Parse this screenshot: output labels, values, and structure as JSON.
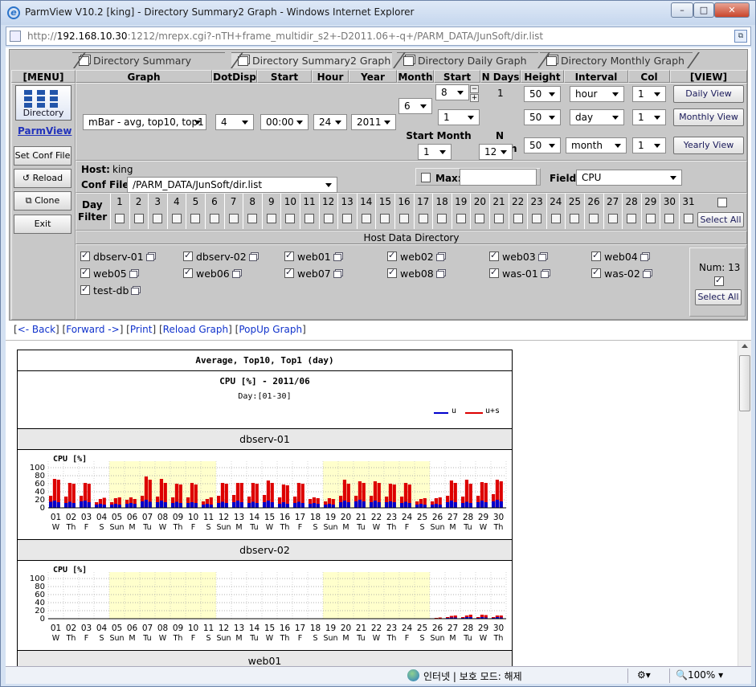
{
  "window": {
    "title": "ParmView V10.2 [king] - Directory Summary2 Graph - Windows Internet Explorer",
    "min": "–",
    "max": "□",
    "close": "✕"
  },
  "address": {
    "prefix": "http://",
    "host": "192.168.10.30",
    "rest": ":1212/mrepx.cgi?-nTH+frame_multidir_s2+-D2011.06+-q+/PARM_DATA/JunSoft/dir.list"
  },
  "tabs": [
    "Directory Summary Graph",
    "Directory Summary2 Graph",
    "Directory Daily Graph",
    "Directory Monthly Graph"
  ],
  "headers": {
    "menu": "[MENU]",
    "graph": "Graph",
    "dotdisp": "DotDisp",
    "starthour": "Start hour",
    "hour": "Hour",
    "year": "Year",
    "month": "Month",
    "startday": "Start Day",
    "ndays": "N Days",
    "height": "Height",
    "interval": "Interval",
    "col": "Col",
    "view": "[VIEW]",
    "startmonth": "Start Month",
    "nmonth": "N Month"
  },
  "menu": {
    "directory": "Directory",
    "parmview": "ParmView",
    "setconf": "Set Conf File",
    "reload": "Reload",
    "clone": "Clone",
    "exit": "Exit"
  },
  "controls": {
    "graph": "mBar - avg, top10, top1",
    "dotdisp": "4",
    "starthour": "00:00",
    "hour": "24",
    "year": "2011",
    "month": "6",
    "startday": "8",
    "ndays": "1",
    "startday2": "1",
    "height1": "50",
    "height2": "50",
    "height3": "50",
    "interval1": "hour",
    "interval2": "day",
    "interval3": "month",
    "col1": "1",
    "col2": "1",
    "col3": "1",
    "startmonth": "1",
    "nmonth": "12",
    "spinup": "−",
    "spindown": "+"
  },
  "view": {
    "daily": "Daily View",
    "monthly": "Monthly View",
    "yearly": "Yearly View"
  },
  "host": {
    "label": "Host:",
    "value": "king",
    "conflabel": "Conf File:",
    "confvalue": "/PARM_DATA/JunSoft/dir.list",
    "maxlabel": "Max:",
    "fieldlabel": "Field:",
    "fieldvalue": "CPU"
  },
  "dayfilter": {
    "label1": "Day",
    "label2": "Filter",
    "days": [
      "1",
      "2",
      "3",
      "4",
      "5",
      "6",
      "7",
      "8",
      "9",
      "10",
      "11",
      "12",
      "13",
      "14",
      "15",
      "16",
      "17",
      "18",
      "19",
      "20",
      "21",
      "22",
      "23",
      "24",
      "25",
      "26",
      "27",
      "28",
      "29",
      "30",
      "31"
    ],
    "selectall": "Select All"
  },
  "hostdir": {
    "title": "Host Data Directory",
    "hosts": [
      "dbserv-01",
      "dbserv-02",
      "web01",
      "web02",
      "web03",
      "web04",
      "web05",
      "web06",
      "web07",
      "web08",
      "was-01",
      "was-02",
      "test-db"
    ],
    "num": "Num: 13",
    "selectall": "Select All"
  },
  "links": {
    "back": "<- Back",
    "forward": "Forward ->",
    "print": "Print",
    "reload": "Reload Graph",
    "popup": "PopUp Graph"
  },
  "graph": {
    "title": "Average, Top10, Top1 (day)",
    "subtitle": "CPU [%] - 2011/06",
    "days_label": "Day:[01-30]",
    "legend": [
      {
        "name": "u",
        "color": "#0000cc"
      },
      {
        "name": "u+s",
        "color": "#dd0000"
      }
    ],
    "chart_label": "CPU [%]",
    "next_host_partial": "web01"
  },
  "status": {
    "text": "인터넷 | 보호 모드: 해제",
    "zoom": "100%"
  },
  "chart_data": [
    {
      "type": "bar",
      "title": "dbserv-01",
      "ylabel": "CPU [%]",
      "ylim": [
        0,
        100
      ],
      "yticks": [
        0,
        20,
        40,
        60,
        80,
        100
      ],
      "categories": [
        "01",
        "02",
        "03",
        "04",
        "05",
        "06",
        "07",
        "08",
        "09",
        "10",
        "11",
        "12",
        "13",
        "14",
        "15",
        "16",
        "17",
        "18",
        "19",
        "20",
        "21",
        "22",
        "23",
        "24",
        "25",
        "26",
        "27",
        "28",
        "29",
        "30"
      ],
      "weekdays": [
        "W",
        "Th",
        "F",
        "S",
        "Sun",
        "M",
        "Tu",
        "W",
        "Th",
        "F",
        "S",
        "Sun",
        "M",
        "Tu",
        "W",
        "Th",
        "F",
        "S",
        "Sun",
        "M",
        "Tu",
        "W",
        "Th",
        "F",
        "S",
        "Sun",
        "M",
        "Tu",
        "W",
        "Th"
      ],
      "weekend_bands": [
        [
          "05",
          "11"
        ],
        [
          "19",
          "25"
        ]
      ],
      "series": [
        {
          "name": "u",
          "color": "#0000cc",
          "values": [
            [
              15,
              18,
              14
            ],
            [
              12,
              15,
              12
            ],
            [
              16,
              18,
              14
            ],
            [
              8,
              10,
              8
            ],
            [
              8,
              10,
              8
            ],
            [
              10,
              12,
              10
            ],
            [
              16,
              20,
              15
            ],
            [
              14,
              18,
              14
            ],
            [
              12,
              15,
              12
            ],
            [
              12,
              14,
              12
            ],
            [
              8,
              10,
              8
            ],
            [
              12,
              15,
              12
            ],
            [
              14,
              18,
              14
            ],
            [
              12,
              15,
              12
            ],
            [
              14,
              18,
              14
            ],
            [
              10,
              14,
              10
            ],
            [
              12,
              15,
              12
            ],
            [
              10,
              12,
              10
            ],
            [
              8,
              10,
              8
            ],
            [
              14,
              18,
              14
            ],
            [
              16,
              20,
              16
            ],
            [
              14,
              18,
              14
            ],
            [
              14,
              16,
              14
            ],
            [
              12,
              15,
              12
            ],
            [
              8,
              10,
              8
            ],
            [
              8,
              10,
              8
            ],
            [
              14,
              18,
              14
            ],
            [
              12,
              15,
              12
            ],
            [
              14,
              18,
              14
            ],
            [
              16,
              20,
              16
            ]
          ]
        },
        {
          "name": "u+s",
          "color": "#dd0000",
          "values": [
            [
              30,
              72,
              70
            ],
            [
              28,
              62,
              60
            ],
            [
              30,
              62,
              60
            ],
            [
              14,
              22,
              25
            ],
            [
              14,
              24,
              26
            ],
            [
              20,
              26,
              22
            ],
            [
              30,
              78,
              70
            ],
            [
              28,
              72,
              62
            ],
            [
              26,
              60,
              58
            ],
            [
              26,
              62,
              58
            ],
            [
              16,
              22,
              26
            ],
            [
              30,
              62,
              60
            ],
            [
              32,
              62,
              62
            ],
            [
              28,
              62,
              60
            ],
            [
              32,
              68,
              62
            ],
            [
              26,
              58,
              56
            ],
            [
              28,
              62,
              60
            ],
            [
              22,
              26,
              24
            ],
            [
              16,
              24,
              22
            ],
            [
              30,
              70,
              60
            ],
            [
              30,
              66,
              62
            ],
            [
              30,
              66,
              62
            ],
            [
              28,
              60,
              58
            ],
            [
              28,
              62,
              58
            ],
            [
              16,
              22,
              24
            ],
            [
              16,
              24,
              26
            ],
            [
              30,
              68,
              62
            ],
            [
              28,
              70,
              60
            ],
            [
              30,
              64,
              62
            ],
            [
              34,
              70,
              66
            ]
          ]
        }
      ]
    },
    {
      "type": "bar",
      "title": "dbserv-02",
      "ylabel": "CPU [%]",
      "ylim": [
        0,
        100
      ],
      "yticks": [
        0,
        20,
        40,
        60,
        80,
        100
      ],
      "categories": [
        "01",
        "02",
        "03",
        "04",
        "05",
        "06",
        "07",
        "08",
        "09",
        "10",
        "11",
        "12",
        "13",
        "14",
        "15",
        "16",
        "17",
        "18",
        "19",
        "20",
        "21",
        "22",
        "23",
        "24",
        "25",
        "26",
        "27",
        "28",
        "29",
        "30"
      ],
      "weekdays": [
        "W",
        "Th",
        "F",
        "S",
        "Sun",
        "M",
        "Tu",
        "W",
        "Th",
        "F",
        "S",
        "Sun",
        "M",
        "Tu",
        "W",
        "Th",
        "F",
        "S",
        "Sun",
        "M",
        "Tu",
        "W",
        "Th",
        "F",
        "S",
        "Sun",
        "M",
        "Tu",
        "W",
        "Th"
      ],
      "weekend_bands": [
        [
          "05",
          "11"
        ],
        [
          "19",
          "25"
        ]
      ],
      "series": [
        {
          "name": "u",
          "color": "#0000cc",
          "values": [
            [
              0,
              0,
              0
            ],
            [
              0,
              0,
              0
            ],
            [
              0,
              0,
              0
            ],
            [
              0,
              0,
              0
            ],
            [
              0,
              0,
              0
            ],
            [
              0,
              0,
              0
            ],
            [
              0,
              0,
              0
            ],
            [
              0,
              0,
              0
            ],
            [
              0,
              0,
              0
            ],
            [
              0,
              0,
              0
            ],
            [
              0,
              0,
              0
            ],
            [
              0,
              0,
              0
            ],
            [
              0,
              0,
              0
            ],
            [
              0,
              0,
              0
            ],
            [
              0,
              0,
              0
            ],
            [
              0,
              0,
              0
            ],
            [
              0,
              0,
              0
            ],
            [
              0,
              0,
              0
            ],
            [
              0,
              0,
              0
            ],
            [
              0,
              0,
              0
            ],
            [
              0,
              0,
              0
            ],
            [
              0,
              0,
              0
            ],
            [
              0,
              0,
              0
            ],
            [
              0,
              0,
              0
            ],
            [
              0,
              0,
              0
            ],
            [
              0,
              0,
              0
            ],
            [
              2,
              3,
              3
            ],
            [
              2,
              4,
              4
            ],
            [
              2,
              4,
              3
            ],
            [
              2,
              4,
              3
            ]
          ]
        },
        {
          "name": "u+s",
          "color": "#dd0000",
          "values": [
            [
              0,
              0,
              0
            ],
            [
              0,
              0,
              0
            ],
            [
              0,
              0,
              0
            ],
            [
              0,
              0,
              0
            ],
            [
              0,
              0,
              0
            ],
            [
              0,
              0,
              0
            ],
            [
              0,
              0,
              0
            ],
            [
              0,
              0,
              0
            ],
            [
              0,
              0,
              0
            ],
            [
              0,
              0,
              0
            ],
            [
              0,
              0,
              0
            ],
            [
              0,
              0,
              0
            ],
            [
              0,
              0,
              0
            ],
            [
              0,
              0,
              0
            ],
            [
              0,
              0,
              0
            ],
            [
              0,
              0,
              0
            ],
            [
              0,
              0,
              0
            ],
            [
              0,
              0,
              0
            ],
            [
              0,
              0,
              0
            ],
            [
              0,
              0,
              0
            ],
            [
              0,
              0,
              0
            ],
            [
              0,
              0,
              0
            ],
            [
              0,
              0,
              0
            ],
            [
              0,
              0,
              0
            ],
            [
              0,
              0,
              0
            ],
            [
              1,
              2,
              3
            ],
            [
              4,
              7,
              8
            ],
            [
              4,
              8,
              10
            ],
            [
              4,
              10,
              9
            ],
            [
              4,
              8,
              8
            ]
          ]
        }
      ]
    }
  ]
}
